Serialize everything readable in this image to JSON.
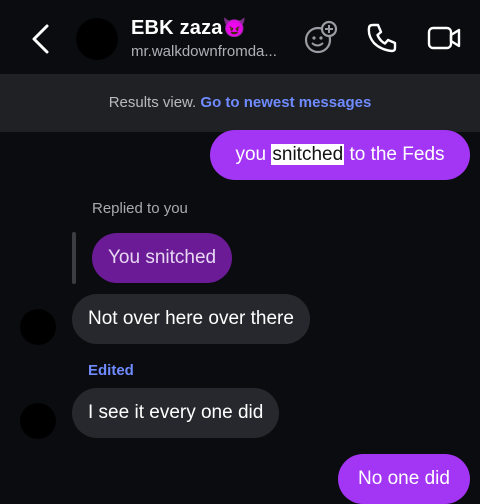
{
  "header": {
    "title": "EBK zaza",
    "title_emoji": "😈",
    "subtitle": "mr.walkdownfromda..."
  },
  "banner": {
    "text": "Results view.",
    "link": "Go to newest messages"
  },
  "messages": {
    "m1": {
      "before": "you ",
      "highlight": "snitched",
      "after": " to the Feds"
    },
    "reply_label": "Replied to you",
    "reply_quote": "You snitched",
    "m2": "Not over here over there",
    "edited_label": "Edited",
    "m3": "I see it every one did",
    "m4": "No one did"
  },
  "colors": {
    "background": "#0b0c0f",
    "my_bubble": "#a335f5",
    "their_bubble": "#26282d",
    "reply_quote": "#6b1b96",
    "link": "#6f8bff"
  },
  "icons": [
    "back-arrow-icon",
    "sticker-add-icon",
    "phone-icon",
    "video-camera-icon"
  ]
}
